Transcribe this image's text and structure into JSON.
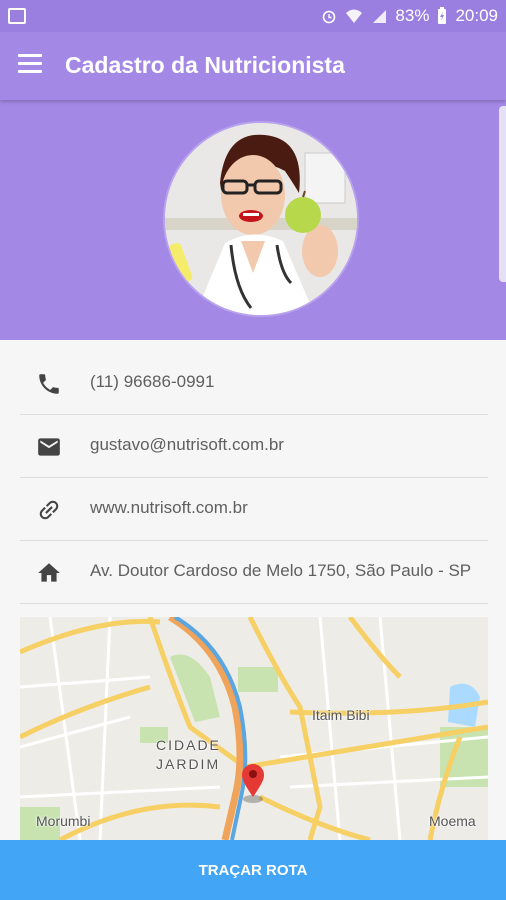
{
  "status_bar": {
    "battery": "83%",
    "time": "20:09"
  },
  "app_bar": {
    "title": "Cadastro da Nutricionista",
    "menu_icon": "hamburger-menu-icon"
  },
  "contact": [
    {
      "icon": "phone-icon",
      "text": "(11) 96686-0991"
    },
    {
      "icon": "email-icon",
      "text": "gustavo@nutrisoft.com.br"
    },
    {
      "icon": "link-icon",
      "text": "www.nutrisoft.com.br"
    },
    {
      "icon": "home-icon",
      "text": "Av. Doutor Cardoso de Melo 1750, São Paulo - SP"
    }
  ],
  "map": {
    "labels": {
      "itaim": "Itaim Bibi",
      "cidade": "CIDADE",
      "jardim": "JARDIM",
      "morumbi": "Morumbi",
      "moema": "Moema"
    },
    "pin_color": "#e53935"
  },
  "route_button": "TRAÇAR ROTA",
  "colors": {
    "primary": "#a488e6",
    "status_bar": "#9b7fe0",
    "button": "#42a5f5"
  }
}
